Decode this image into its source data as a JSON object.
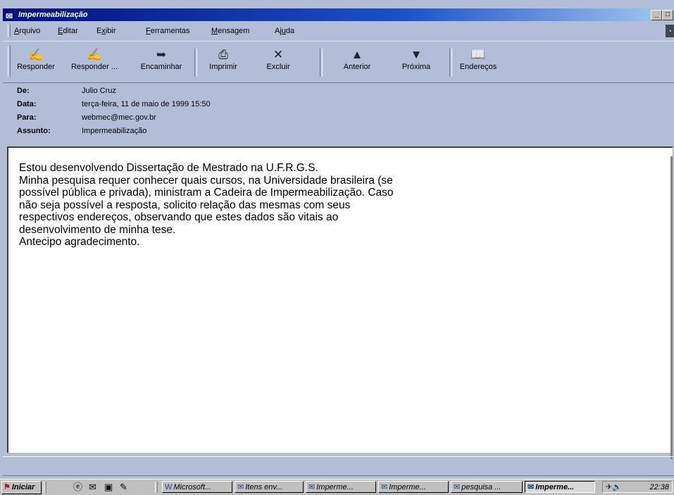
{
  "window": {
    "title": "Impermeabilização"
  },
  "menu": [
    {
      "pre": "",
      "u": "A",
      "post": "rquivo"
    },
    {
      "pre": "",
      "u": "E",
      "post": "ditar"
    },
    {
      "pre": "E",
      "u": "x",
      "post": "ibir"
    },
    {
      "pre": "",
      "u": "F",
      "post": "erramentas"
    },
    {
      "pre": "",
      "u": "M",
      "post": "ensagem"
    },
    {
      "pre": "Aj",
      "u": "u",
      "post": "da"
    }
  ],
  "toolbar": {
    "reply": "Responder",
    "reply_all": "Responder ...",
    "forward": "Encaminhar",
    "print": "Imprimir",
    "delete": "Excluir",
    "previous": "Anterior",
    "next": "Próxima",
    "addresses": "Endereços"
  },
  "headers": {
    "from_label": "De:",
    "from": "Julio Cruz",
    "date_label": "Data:",
    "date": "terça-feira, 11 de maio de 1999 15:50",
    "to_label": "Para:",
    "to": "webmec@mec.gov.br",
    "subject_label": "Assunto:",
    "subject": "Impermeabilização"
  },
  "message": {
    "body": "Estou desenvolvendo Dissertação de Mestrado na U.F.R.G.S.\nMinha pesquisa requer conhecer quais cursos, na Universidade brasileira (se\npossível pública e privada), ministram a Cadeira de Impermeabilização. Caso\nnão seja possível a resposta, solicito relação das mesmas com seus\nrespectivos endereços, observando que estes dados são vitais ao\ndesenvolvimento de minha tese.\nAntecipo agradecimento."
  },
  "taskbar": {
    "start": "Iniciar",
    "tasks": [
      "Microsoft...",
      "Itens env...",
      "Imperme...",
      "Imperme...",
      "pesquisa ...",
      "Imperme..."
    ],
    "clock": "22:38"
  }
}
